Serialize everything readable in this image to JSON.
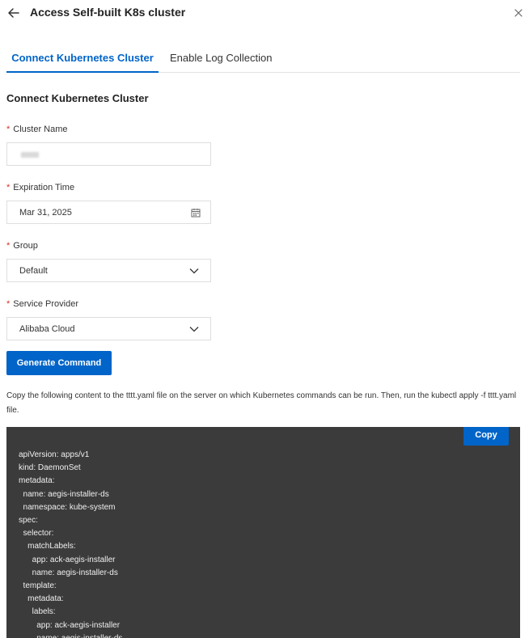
{
  "header": {
    "title": "Access Self-built K8s cluster"
  },
  "tabs": [
    {
      "label": "Connect Kubernetes Cluster",
      "active": true
    },
    {
      "label": "Enable Log Collection",
      "active": false
    }
  ],
  "form": {
    "section_title": "Connect Kubernetes Cluster",
    "required_mark": "*",
    "cluster_name": {
      "label": "Cluster Name",
      "value": ""
    },
    "expiration_time": {
      "label": "Expiration Time",
      "value": "Mar 31, 2025"
    },
    "group": {
      "label": "Group",
      "value": "Default"
    },
    "service_provider": {
      "label": "Service Provider",
      "value": "Alibaba Cloud"
    },
    "generate_button": "Generate Command"
  },
  "instructions": {
    "text": "Copy the following content to the tttt.yaml file on the server on which Kubernetes commands can be run. Then, run the kubectl apply -f tttt.yaml file."
  },
  "code_panel": {
    "copy_button": "Copy",
    "lines": [
      "apiVersion: apps/v1",
      "kind: DaemonSet",
      "metadata:",
      "  name: aegis-installer-ds",
      "  namespace: kube-system",
      "spec:",
      "  selector:",
      "    matchLabels:",
      "      app: ack-aegis-installer",
      "      name: aegis-installer-ds",
      "  template:",
      "    metadata:",
      "      labels:",
      "        app: ack-aegis-installer",
      "        name: aegis-installer-ds"
    ]
  },
  "colors": {
    "primary": "#0064c8",
    "required": "#d93026",
    "code_background": "#3b3b3b"
  },
  "icons": {
    "back": "arrow-left-icon",
    "close": "close-icon",
    "calendar": "calendar-icon",
    "dropdown": "chevron-down-icon"
  }
}
